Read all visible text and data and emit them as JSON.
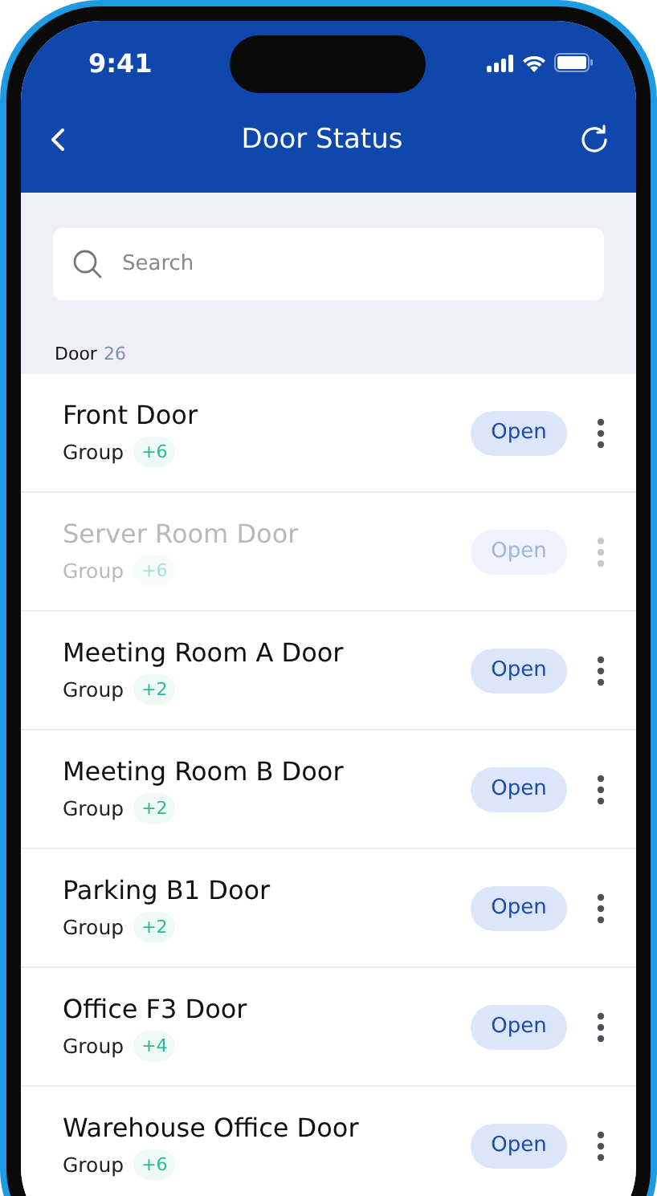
{
  "status_bar": {
    "time": "9:41"
  },
  "header": {
    "title": "Door Status"
  },
  "search": {
    "placeholder": "Search"
  },
  "section": {
    "label": "Door",
    "count": "26"
  },
  "doors": [
    {
      "name": "Front Door",
      "group": "Group",
      "extra": "+6",
      "action": "Open",
      "disabled": false
    },
    {
      "name": "Server Room Door",
      "group": "Group",
      "extra": "+6",
      "action": "Open",
      "disabled": true
    },
    {
      "name": "Meeting Room A Door",
      "group": "Group",
      "extra": "+2",
      "action": "Open",
      "disabled": false
    },
    {
      "name": "Meeting Room B Door",
      "group": "Group",
      "extra": "+2",
      "action": "Open",
      "disabled": false
    },
    {
      "name": "Parking B1 Door",
      "group": "Group",
      "extra": "+2",
      "action": "Open",
      "disabled": false
    },
    {
      "name": "Office F3 Door",
      "group": "Group",
      "extra": "+4",
      "action": "Open",
      "disabled": false
    },
    {
      "name": "Warehouse Office Door",
      "group": "Group",
      "extra": "+6",
      "action": "Open",
      "disabled": false
    }
  ]
}
